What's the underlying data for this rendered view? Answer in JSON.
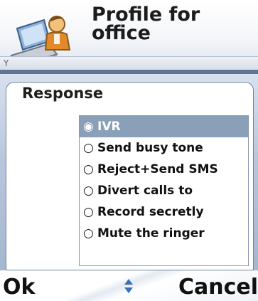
{
  "title": "Profile for\noffice",
  "section_label": "Response",
  "options": [
    {
      "label": "IVR",
      "selected": true
    },
    {
      "label": "Send busy tone",
      "selected": false
    },
    {
      "label": "Reject+Send SMS",
      "selected": false
    },
    {
      "label": "Divert calls to",
      "selected": false
    },
    {
      "label": "Record secretly",
      "selected": false
    },
    {
      "label": "Mute the ringer",
      "selected": false
    }
  ],
  "softkeys": {
    "left": "Ok",
    "right": "Cancel"
  },
  "icons": {
    "app": "profile-person-computer-icon",
    "signal": "signal-strength-icon",
    "scroll": "scroll-updown-icon"
  },
  "colors": {
    "selection": "#8aa0b8",
    "panel_border": "#6f849f",
    "background_blue": "#b7c7db"
  }
}
